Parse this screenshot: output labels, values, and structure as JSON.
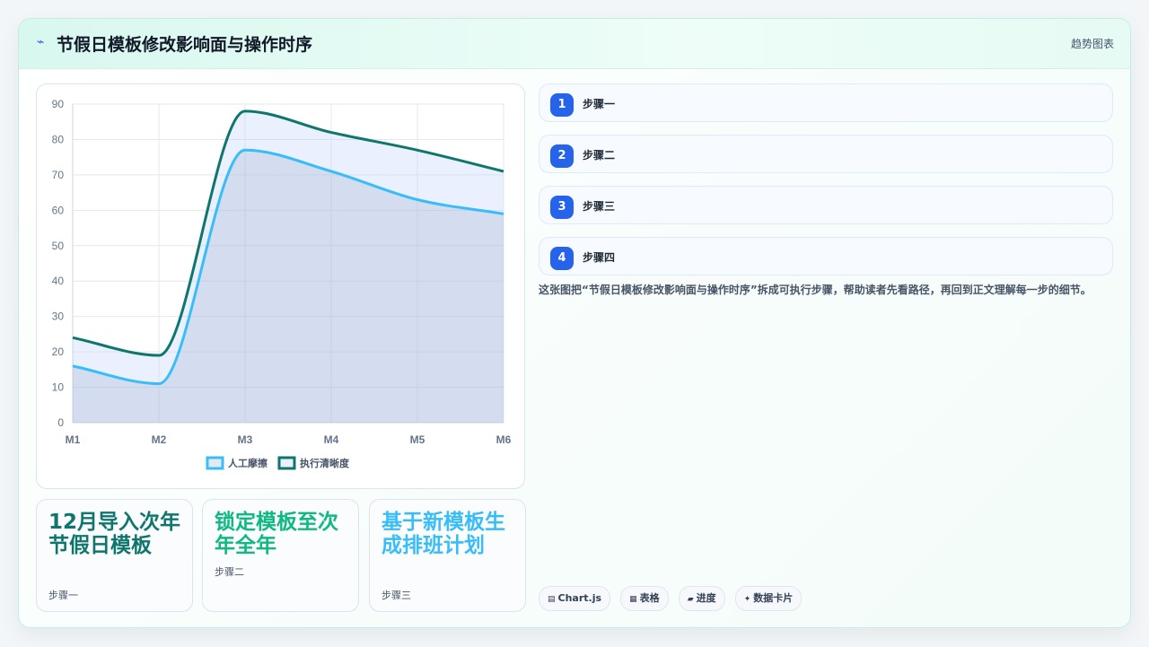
{
  "header": {
    "title": "节假日模板修改影响面与操作时序",
    "tag": "趋势图表",
    "icon": "bolt-icon"
  },
  "chart_data": {
    "type": "area",
    "categories": [
      "M1",
      "M2",
      "M3",
      "M4",
      "M5",
      "M6"
    ],
    "series": [
      {
        "name": "人工摩擦",
        "values": [
          16,
          11,
          77,
          71,
          63,
          59
        ],
        "color": "#38bdf8"
      },
      {
        "name": "执行清晰度",
        "values": [
          24,
          19,
          88,
          82,
          77,
          71
        ],
        "color": "#0f766e"
      }
    ],
    "ylim": [
      0,
      90
    ],
    "yticks": [
      0,
      10,
      20,
      30,
      40,
      50,
      60,
      70,
      80,
      90
    ],
    "grid": true,
    "legend": "bottom"
  },
  "steps": [
    {
      "num": "1",
      "label": "步骤一"
    },
    {
      "num": "2",
      "label": "步骤二"
    },
    {
      "num": "3",
      "label": "步骤三"
    },
    {
      "num": "4",
      "label": "步骤四"
    }
  ],
  "description": "这张图把“节假日模板修改影响面与操作时序”拆成可执行步骤，帮助读者先看路径，再回到正文理解每一步的细节。",
  "kpis": [
    {
      "value": "12月导入次年节假日模板",
      "sub": "步骤一",
      "color": "#0f766e"
    },
    {
      "value": "锁定模板至次年全年",
      "sub": "步骤二",
      "color": "#10b981"
    },
    {
      "value": "基于新模板生成排班计划",
      "sub": "步骤三",
      "color": "#38bdf8"
    }
  ],
  "chips": [
    {
      "icon": "▤",
      "label": "Chart.js"
    },
    {
      "icon": "▦",
      "label": "表格"
    },
    {
      "icon": "▰",
      "label": "进度"
    },
    {
      "icon": "✦",
      "label": "数据卡片"
    }
  ]
}
